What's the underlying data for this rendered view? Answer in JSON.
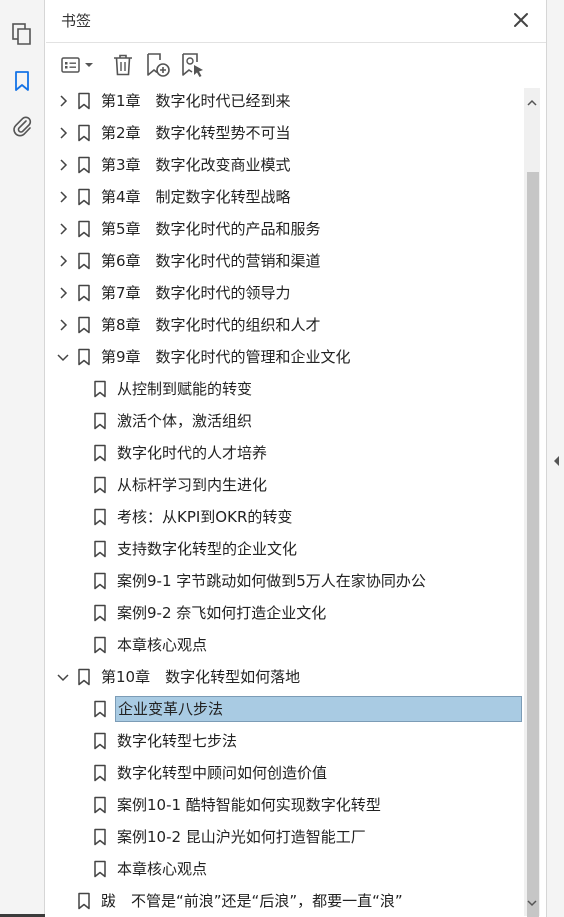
{
  "panel": {
    "title": "书签"
  },
  "rail": {
    "items": [
      {
        "icon": "pages-icon"
      },
      {
        "icon": "bookmark-icon",
        "active": true
      },
      {
        "icon": "attachment-icon"
      }
    ]
  },
  "toolbar": {
    "buttons": [
      {
        "icon": "options-menu-icon"
      },
      {
        "icon": "delete-icon"
      },
      {
        "icon": "new-bookmark-icon"
      },
      {
        "icon": "find-bookmark-icon"
      }
    ]
  },
  "bookmarks": [
    {
      "level": 0,
      "state": "collapsed",
      "label": "第1章　数字化时代已经到来"
    },
    {
      "level": 0,
      "state": "collapsed",
      "label": "第2章　数字化转型势不可当"
    },
    {
      "level": 0,
      "state": "collapsed",
      "label": "第3章　数字化改变商业模式"
    },
    {
      "level": 0,
      "state": "collapsed",
      "label": "第4章　制定数字化转型战略"
    },
    {
      "level": 0,
      "state": "collapsed",
      "label": "第5章　数字化时代的产品和服务"
    },
    {
      "level": 0,
      "state": "collapsed",
      "label": "第6章　数字化时代的营销和渠道"
    },
    {
      "level": 0,
      "state": "collapsed",
      "label": "第7章　数字化时代的领导力"
    },
    {
      "level": 0,
      "state": "collapsed",
      "label": "第8章　数字化时代的组织和人才"
    },
    {
      "level": 0,
      "state": "expanded",
      "label": "第9章　数字化时代的管理和企业文化"
    },
    {
      "level": 1,
      "label": "从控制到赋能的转变"
    },
    {
      "level": 1,
      "label": "激活个体，激活组织"
    },
    {
      "level": 1,
      "label": "数字化时代的人才培养"
    },
    {
      "level": 1,
      "label": "从标杆学习到内生进化"
    },
    {
      "level": 1,
      "label": "考核：从KPI到OKR的转变"
    },
    {
      "level": 1,
      "label": "支持数字化转型的企业文化"
    },
    {
      "level": 1,
      "label": "案例9-1 字节跳动如何做到5万人在家协同办公"
    },
    {
      "level": 1,
      "label": "案例9-2 奈飞如何打造企业文化"
    },
    {
      "level": 1,
      "label": "本章核心观点"
    },
    {
      "level": 0,
      "state": "expanded",
      "label": "第10章　数字化转型如何落地"
    },
    {
      "level": 1,
      "label": "企业变革八步法",
      "selected": true
    },
    {
      "level": 1,
      "label": "数字化转型七步法"
    },
    {
      "level": 1,
      "label": "数字化转型中顾问如何创造价值"
    },
    {
      "level": 1,
      "label": "案例10-1 酷特智能如何实现数字化转型"
    },
    {
      "level": 1,
      "label": "案例10-2 昆山沪光如何打造智能工厂"
    },
    {
      "level": 1,
      "label": "本章核心观点"
    },
    {
      "level": 0,
      "state": "none",
      "label": "跋　不管是“前浪”还是“后浪”，都要一直“浪”"
    }
  ],
  "colors": {
    "accent": "#1473e6",
    "selection": "#a9cbe3",
    "icon": "#555555"
  }
}
